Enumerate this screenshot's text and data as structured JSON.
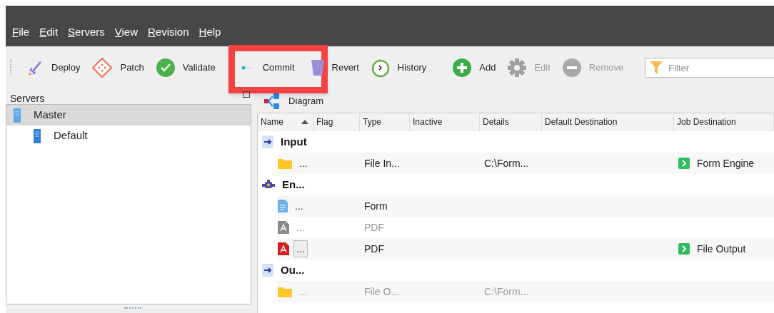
{
  "menu": [
    "File",
    "Edit",
    "Servers",
    "View",
    "Revision",
    "Help"
  ],
  "toolbar": [
    {
      "kind": "grip"
    },
    {
      "kind": "button",
      "label": "Deploy",
      "disabled": false,
      "highlighted": false
    },
    {
      "kind": "button",
      "label": "Patch",
      "disabled": false,
      "highlighted": false
    },
    {
      "kind": "button",
      "label": "Validate",
      "disabled": false,
      "highlighted": false
    },
    {
      "kind": "separator"
    },
    {
      "kind": "button",
      "label": "Commit",
      "disabled": false,
      "highlighted": true
    },
    {
      "kind": "button",
      "label": "Revert",
      "disabled": false,
      "highlighted": false
    },
    {
      "kind": "button",
      "label": "History",
      "disabled": false,
      "highlighted": false
    },
    {
      "kind": "separator"
    },
    {
      "kind": "button",
      "label": "Add",
      "disabled": false,
      "highlighted": false
    },
    {
      "kind": "button",
      "label": "Edit",
      "disabled": true,
      "highlighted": false
    },
    {
      "kind": "button",
      "label": "Remove",
      "disabled": true,
      "highlighted": false
    },
    {
      "kind": "separator"
    },
    {
      "kind": "filter",
      "placeholder": "Filter"
    }
  ],
  "sidebar": {
    "title": "Servers",
    "items": [
      {
        "label": "Master",
        "selected": true,
        "children": [
          {
            "label": "Default",
            "selected": false
          }
        ]
      }
    ]
  },
  "diagram_button": "Diagram",
  "table": {
    "columns": [
      {
        "label": "Name",
        "sorted": true
      },
      {
        "label": "Flag",
        "sorted": false
      },
      {
        "label": "Type",
        "sorted": false
      },
      {
        "label": "Inactive",
        "sorted": false
      },
      {
        "label": "Details",
        "sorted": false
      },
      {
        "label": "Default Destination",
        "sorted": false
      },
      {
        "label": "Job Destination",
        "sorted": false
      }
    ],
    "rows": [
      {
        "kind": "group",
        "name": "Input"
      },
      {
        "kind": "item",
        "name": "...",
        "type": "File In...",
        "details": "C:\\Form...",
        "job_destination": "Form Engine",
        "disabled": false,
        "selected": false
      },
      {
        "kind": "group",
        "name": "En..."
      },
      {
        "kind": "item",
        "name": "...",
        "type": "Form",
        "disabled": false,
        "selected": false
      },
      {
        "kind": "item",
        "name": "...",
        "type": "PDF",
        "disabled": true,
        "selected": false
      },
      {
        "kind": "item",
        "name": "...",
        "type": "PDF",
        "job_destination": "File Output",
        "disabled": false,
        "selected": true
      },
      {
        "kind": "group",
        "name": "Ou..."
      },
      {
        "kind": "item",
        "name": "...",
        "type": "File O...",
        "details": "C:\\Form...",
        "disabled": true,
        "selected": false
      }
    ]
  }
}
